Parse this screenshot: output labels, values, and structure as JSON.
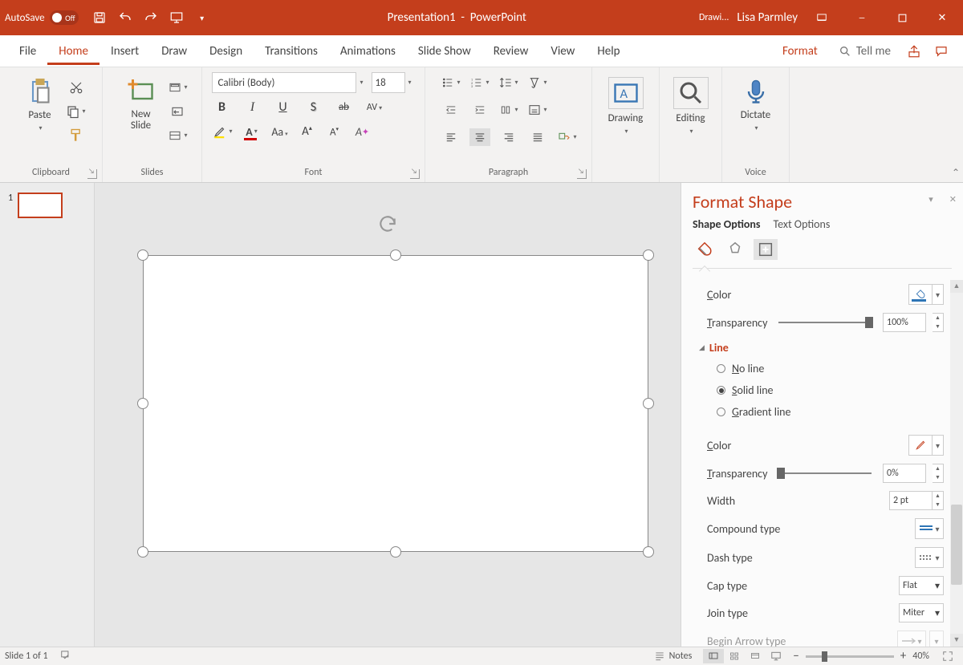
{
  "title": {
    "autosave_label": "AutoSave",
    "autosave_state": "Off",
    "doc_name": "Presentation1",
    "app_name": "PowerPoint",
    "context_tool": "Drawi...",
    "user_name": "Lisa Parmley"
  },
  "tabs": [
    "File",
    "Home",
    "Insert",
    "Draw",
    "Design",
    "Transitions",
    "Animations",
    "Slide Show",
    "Review",
    "View",
    "Help"
  ],
  "active_tab_index": 1,
  "format_tab": "Format",
  "tell_me": "Tell me",
  "ribbon": {
    "clipboard": {
      "paste": "Paste",
      "label": "Clipboard"
    },
    "slides": {
      "new_slide": "New\nSlide",
      "label": "Slides"
    },
    "font": {
      "name": "Calibri (Body)",
      "size": "18",
      "label": "Font"
    },
    "paragraph": {
      "label": "Paragraph"
    },
    "drawing": {
      "btn": "Drawing",
      "label": ""
    },
    "editing": {
      "btn": "Editing",
      "label": ""
    },
    "voice": {
      "btn": "Dictate",
      "label": "Voice"
    }
  },
  "thumbs": {
    "num1": "1"
  },
  "format_pane": {
    "title": "Format Shape",
    "tabs": {
      "shape": "Shape Options",
      "text": "Text Options"
    },
    "color_label": "Color",
    "transparency_label": "Transparency",
    "trans_fill_val": "100%",
    "line_section": "Line",
    "no_line": "No line",
    "solid_line": "Solid line",
    "gradient_line": "Gradient line",
    "trans_line_val": "0%",
    "width_label": "Width",
    "width_val": "2 pt",
    "compound_label": "Compound type",
    "dash_label": "Dash type",
    "cap_label": "Cap type",
    "cap_val": "Flat",
    "join_label": "Join type",
    "join_val": "Miter",
    "begin_arrow_label": "Begin Arrow type"
  },
  "status": {
    "slide_pos": "Slide 1 of 1",
    "notes": "Notes",
    "zoom": "40%",
    "zoom_minus": "−",
    "zoom_plus": "+"
  }
}
